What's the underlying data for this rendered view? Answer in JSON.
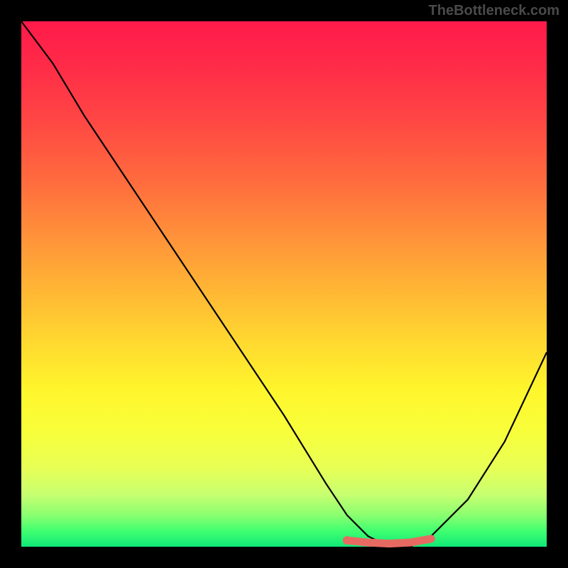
{
  "watermark": "TheBottleneck.com",
  "chart_data": {
    "type": "line",
    "title": "",
    "xlabel": "",
    "ylabel": "",
    "xlim": [
      0,
      100
    ],
    "ylim": [
      0,
      100
    ],
    "series": [
      {
        "name": "bottleneck-curve",
        "x": [
          0,
          6,
          12,
          20,
          30,
          40,
          50,
          58,
          62,
          66,
          70,
          74,
          78,
          85,
          92,
          100
        ],
        "values": [
          100,
          92,
          82,
          70,
          55,
          40,
          25,
          12,
          6,
          2,
          0,
          0,
          2,
          9,
          20,
          37
        ]
      },
      {
        "name": "highlight-segment",
        "x": [
          62,
          66,
          70,
          74,
          78
        ],
        "values": [
          1.2,
          0.8,
          0.6,
          0.8,
          1.5
        ]
      }
    ],
    "colors": {
      "curve": "#000000",
      "highlight": "#e76a62",
      "gradient_top": "#ff1a4a",
      "gradient_bottom": "#10e878"
    }
  }
}
